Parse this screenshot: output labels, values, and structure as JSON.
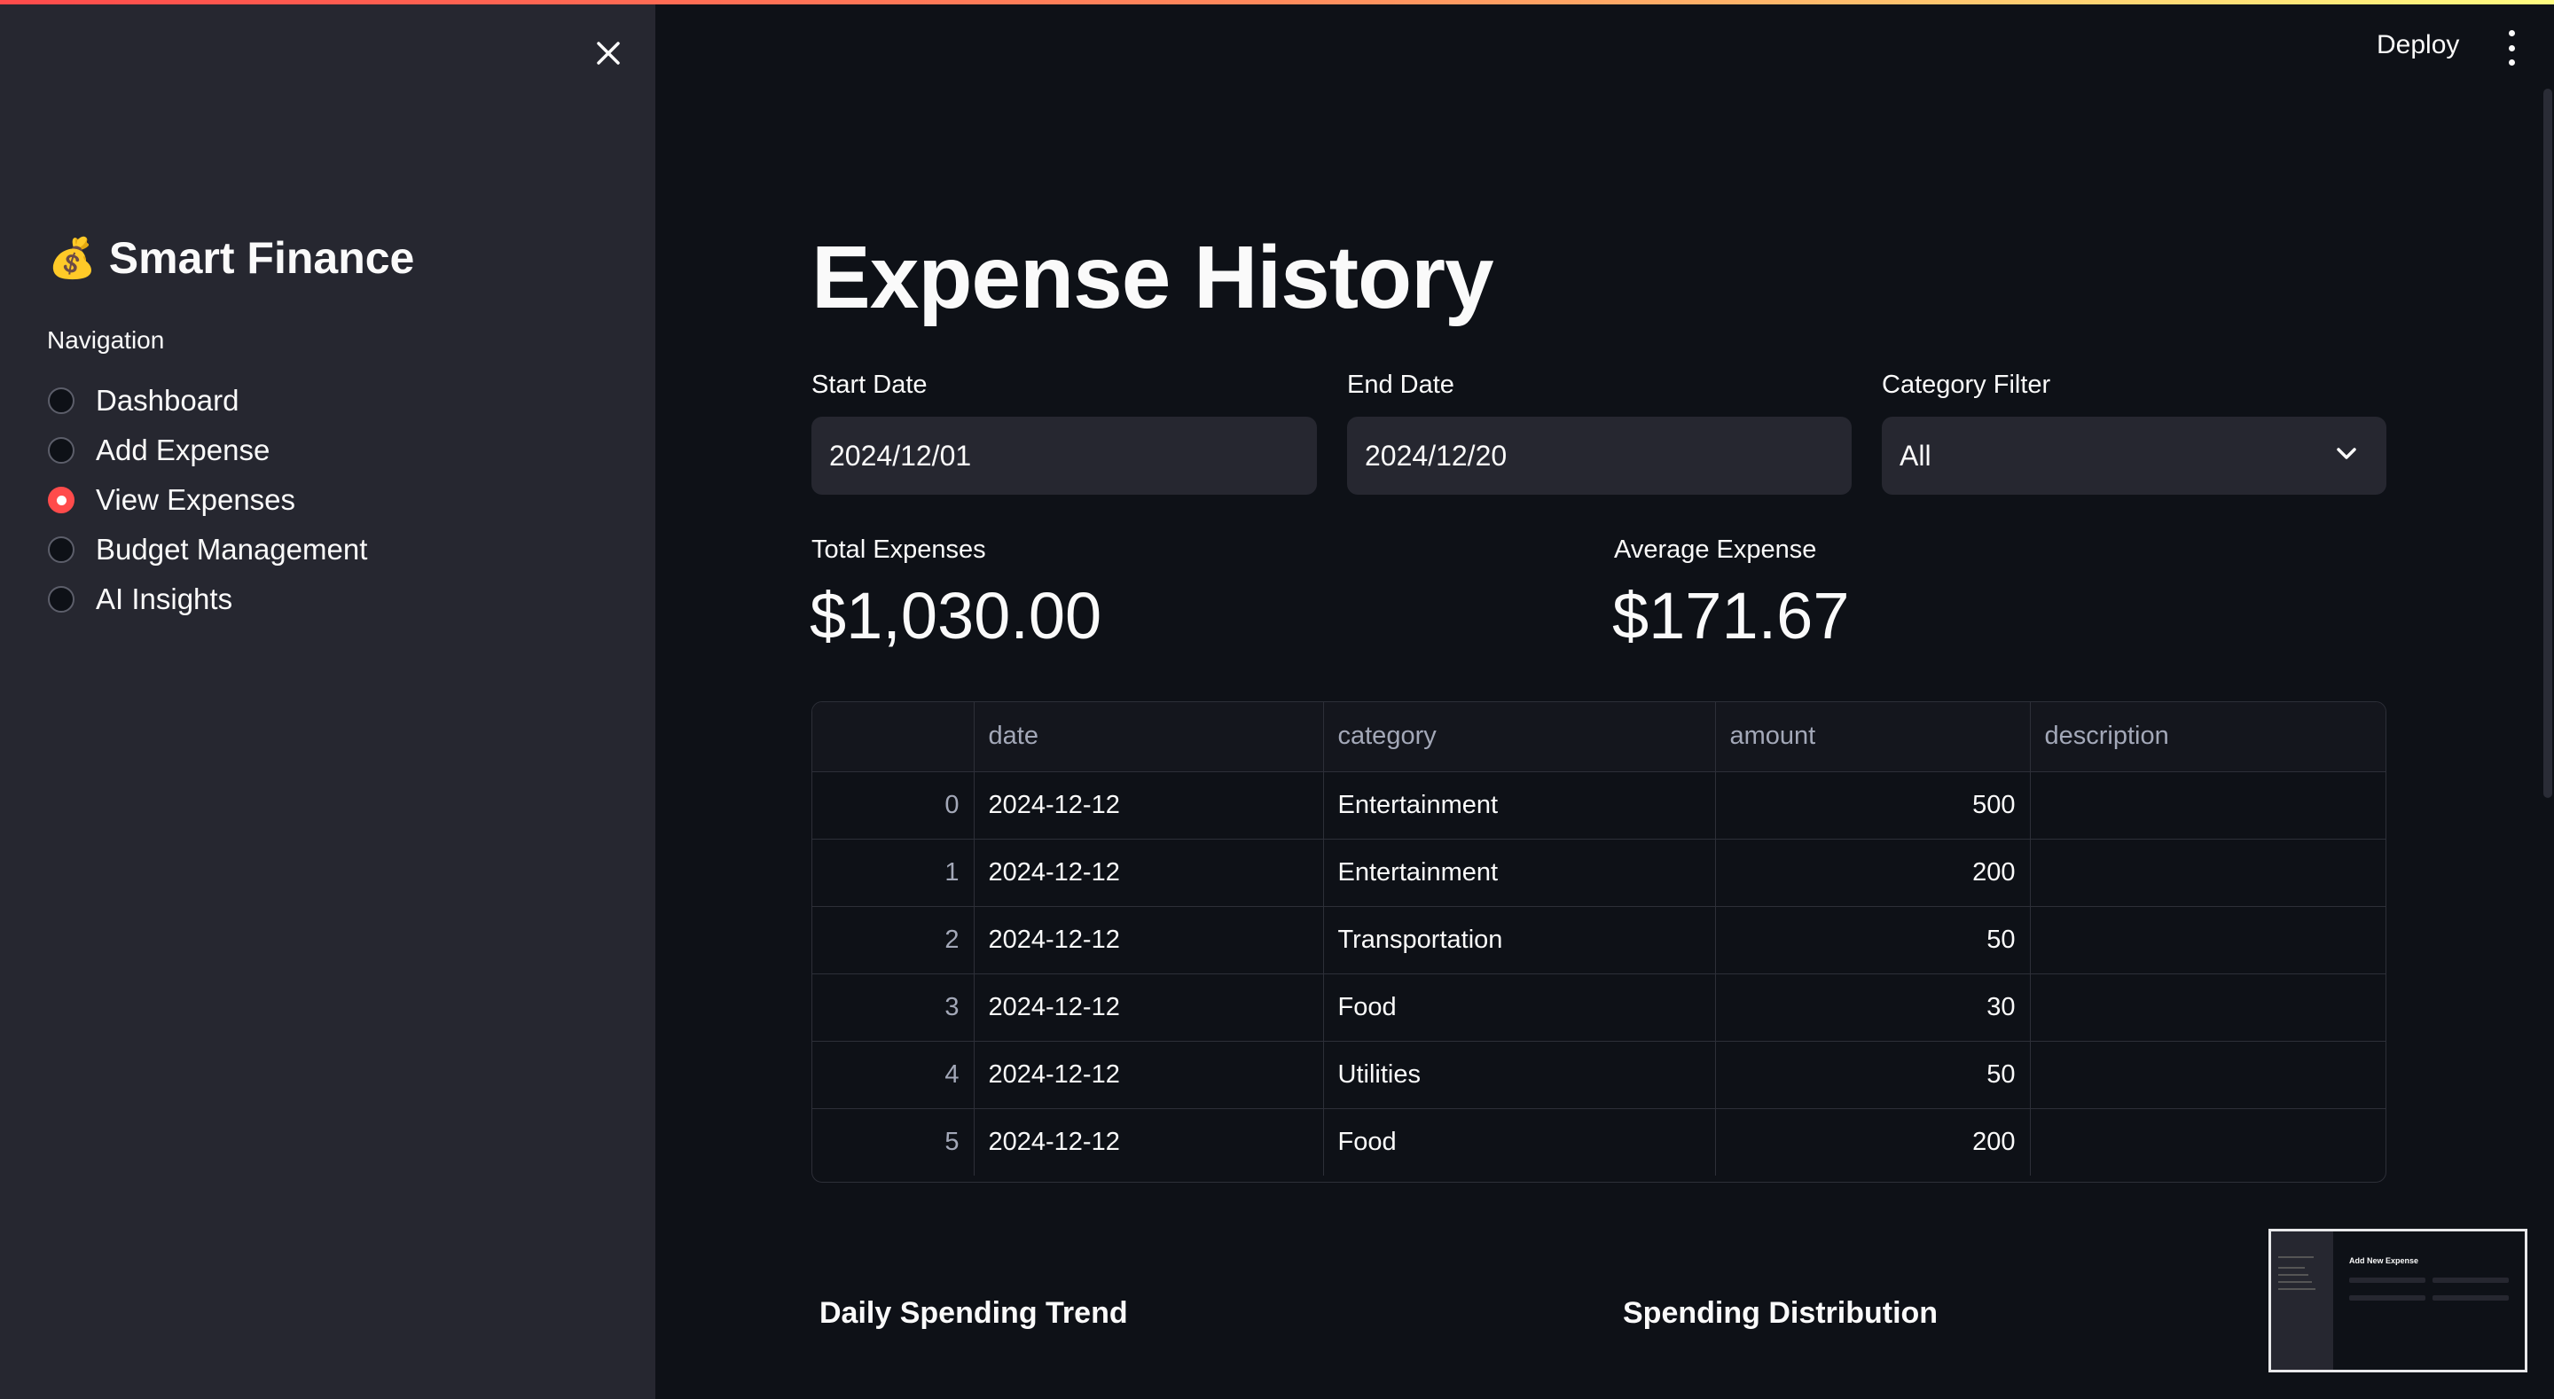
{
  "sidebar": {
    "brand_icon": "💰",
    "brand": "Smart Finance",
    "nav_label": "Navigation",
    "nav_items": [
      {
        "label": "Dashboard",
        "selected": false
      },
      {
        "label": "Add Expense",
        "selected": false
      },
      {
        "label": "View Expenses",
        "selected": true
      },
      {
        "label": "Budget Management",
        "selected": false
      },
      {
        "label": "AI Insights",
        "selected": false
      }
    ]
  },
  "header": {
    "deploy_label": "Deploy"
  },
  "main": {
    "title": "Expense History",
    "filters": {
      "start_date_label": "Start Date",
      "start_date_value": "2024/12/01",
      "end_date_label": "End Date",
      "end_date_value": "2024/12/20",
      "category_label": "Category Filter",
      "category_value": "All"
    },
    "metrics": {
      "total_label": "Total Expenses",
      "total_value": "$1,030.00",
      "average_label": "Average Expense",
      "average_value": "$171.67"
    },
    "table": {
      "columns": [
        "",
        "date",
        "category",
        "amount",
        "description"
      ],
      "rows": [
        [
          "0",
          "2024-12-12",
          "Entertainment",
          "500",
          ""
        ],
        [
          "1",
          "2024-12-12",
          "Entertainment",
          "200",
          ""
        ],
        [
          "2",
          "2024-12-12",
          "Transportation",
          "50",
          ""
        ],
        [
          "3",
          "2024-12-12",
          "Food",
          "30",
          ""
        ],
        [
          "4",
          "2024-12-12",
          "Utilities",
          "50",
          ""
        ],
        [
          "5",
          "2024-12-12",
          "Food",
          "200",
          ""
        ]
      ]
    },
    "sections": {
      "daily_trend": "Daily Spending Trend",
      "distribution": "Spending Distribution"
    }
  },
  "thumbnail": {
    "title": "Add New Expense"
  },
  "colors": {
    "accent": "#ff4b4b",
    "background": "#0e1117",
    "sidebar": "#262730"
  }
}
